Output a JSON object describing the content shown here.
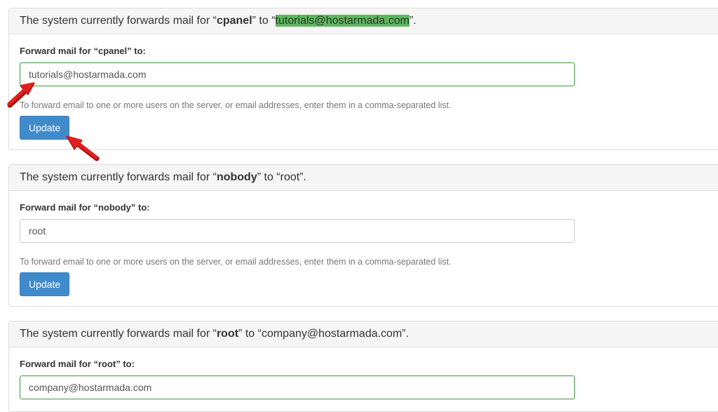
{
  "forwarders": [
    {
      "heading_prefix": "The system currently forwards mail for “",
      "account": "cpanel",
      "heading_middle": "” to “",
      "destination": "tutorials@hostarmada.com",
      "heading_suffix": "”.",
      "label": "Forward mail for “cpanel” to:",
      "input_value": "tutorials@hostarmada.com",
      "help_text": "To forward email to one or more users on the server, or email addresses, enter them in a comma-separated list.",
      "button_label": "Update"
    },
    {
      "heading_prefix": "The system currently forwards mail for “",
      "account": "nobody",
      "heading_middle": "” to “",
      "destination": "root",
      "heading_suffix": "”.",
      "label": "Forward mail for “nobody” to:",
      "input_value": "root",
      "help_text": "To forward email to one or more users on the server, or email addresses, enter them in a comma-separated list.",
      "button_label": "Update"
    },
    {
      "heading_prefix": "The system currently forwards mail for “",
      "account": "root",
      "heading_middle": "” to “",
      "destination": "company@hostarmada.com",
      "heading_suffix": "”.",
      "label": "Forward mail for “root” to:",
      "input_value": "company@hostarmada.com"
    }
  ],
  "colors": {
    "highlight": "#5cb85c",
    "button": "#428bca",
    "annotation_arrow": "#e02020",
    "input_success_border": "#3c9a3c"
  }
}
